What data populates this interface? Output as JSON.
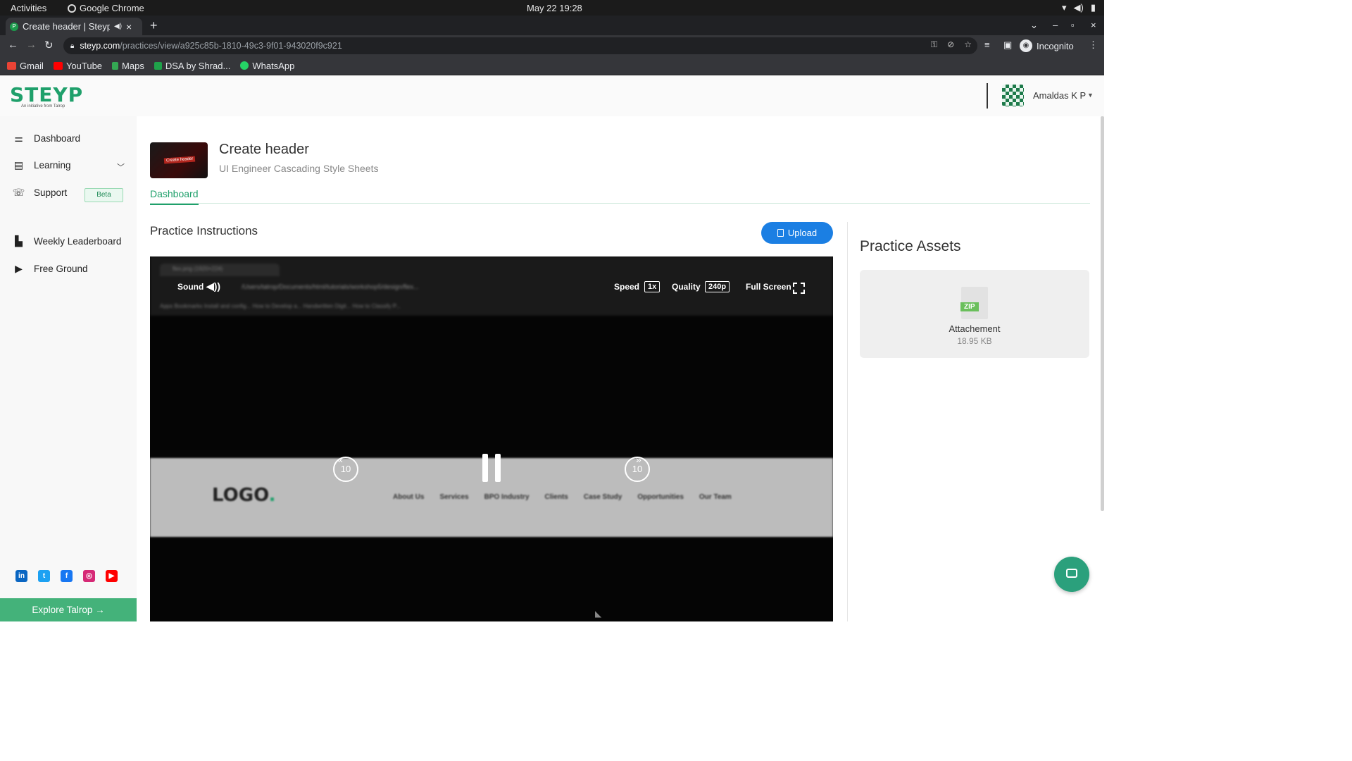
{
  "os": {
    "activities": "Activities",
    "app": "Google Chrome",
    "clock": "May 22  19:28"
  },
  "browser": {
    "tab_title": "Create header | Steyp's",
    "url_host": "steyp.com",
    "url_path": "/practices/view/a925c85b-1810-49c3-9f01-943020f9c921",
    "profile": "Incognito",
    "bookmarks": [
      {
        "label": "Gmail",
        "color": "#ea4335"
      },
      {
        "label": "YouTube",
        "color": "#ff0000"
      },
      {
        "label": "Maps",
        "color": "#34a853"
      },
      {
        "label": "DSA by Shrad...",
        "color": "#1fa24a"
      },
      {
        "label": "WhatsApp",
        "color": "#25d366"
      }
    ]
  },
  "header": {
    "logo": "STEYP",
    "logo_tagline": "An initiative from Talrop",
    "user_name": "Amaldas K P"
  },
  "sidebar": {
    "items": [
      {
        "label": "Dashboard",
        "icon": "dashboard-icon"
      },
      {
        "label": "Learning",
        "icon": "calendar-icon"
      },
      {
        "label": "Support",
        "icon": "support-icon"
      },
      {
        "label": "Weekly Leaderboard",
        "icon": "leaderboard-icon"
      },
      {
        "label": "Free Ground",
        "icon": "play-screen-icon"
      }
    ],
    "beta_badge": "Beta",
    "explore_label": "Explore Talrop",
    "socials": [
      "linkedin-icon",
      "twitter-icon",
      "facebook-icon",
      "instagram-icon",
      "youtube-icon"
    ]
  },
  "course": {
    "thumb_label": "Create header",
    "title": "Create header",
    "subtitle": "UI Engineer Cascading Style Sheets",
    "tab": "Dashboard"
  },
  "practice": {
    "section_title": "Practice Instructions",
    "upload_label": "Upload"
  },
  "video": {
    "sound_label": "Sound",
    "speed_label": "Speed",
    "speed_value": "1x",
    "quality_label": "Quality",
    "quality_value": "240p",
    "fullscreen_label": "Full Screen",
    "skip_back": "10",
    "skip_forward": "10",
    "blur_tab": "flex.png (1920×224)",
    "blur_url": "/Users/talrop/Documents/html/tutorials/workshop5/design/flex...",
    "blur_bookmarks": "Apps   Bookmarks   Install and config...   How to Develop a...   Handwritten Digit...   How to Classify P...",
    "banner_logo": "LOGO",
    "banner_logo_dot": ".",
    "banner_nav": [
      "About Us",
      "Services",
      "BPO Industry",
      "Clients",
      "Case Study",
      "Opportunities",
      "Our Team"
    ]
  },
  "assets": {
    "title": "Practice Assets",
    "file_type": "ZIP",
    "file_name": "Attachement",
    "file_size": "18.95 KB"
  }
}
